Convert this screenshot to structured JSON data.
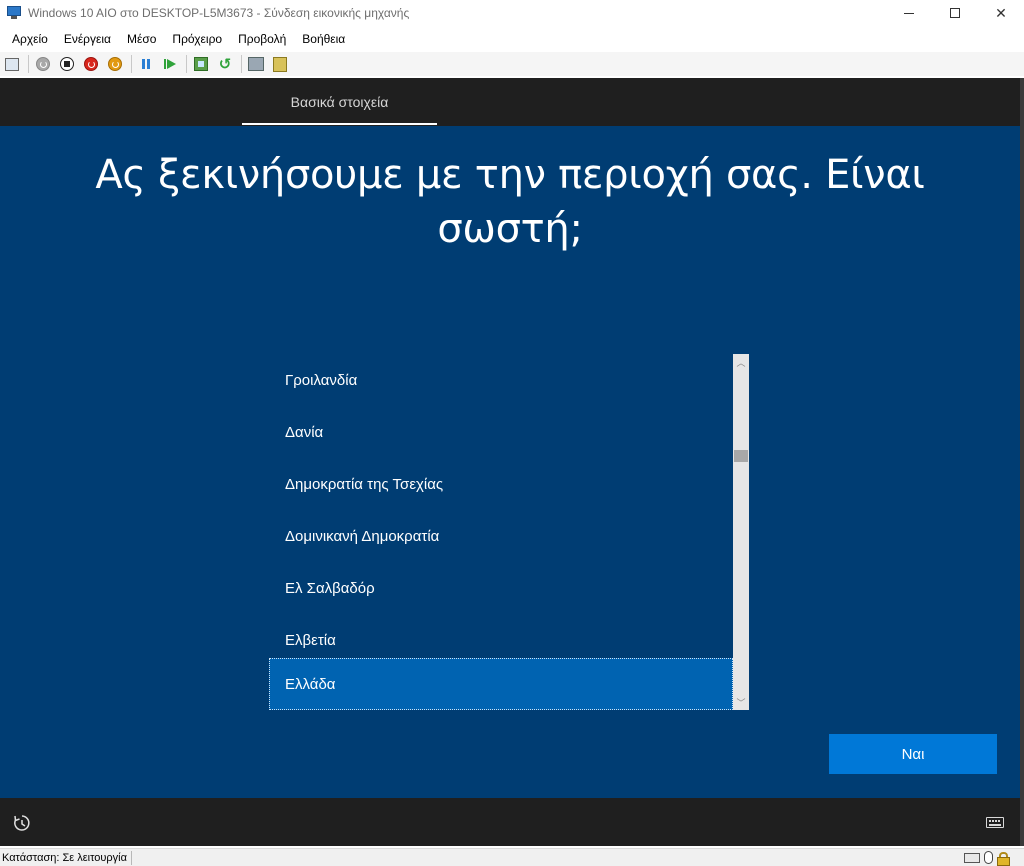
{
  "window": {
    "title": "Windows 10 AIO στο DESKTOP-L5M3673 - Σύνδεση εικονικής μηχανής",
    "close_glyph": "✕"
  },
  "menu": {
    "items": [
      "Αρχείο",
      "Ενέργεια",
      "Μέσο",
      "Πρόχειρο",
      "Προβολή",
      "Βοήθεια"
    ]
  },
  "toolbar": {
    "icons": [
      "ctrl-alt-del-icon",
      "start-icon",
      "turn-off-icon",
      "shut-down-icon",
      "save-icon",
      "pause-icon",
      "resume-icon",
      "checkpoint-icon",
      "revert-icon",
      "enhanced-session-icon",
      "share-icon"
    ],
    "undo_glyph": "↺"
  },
  "oobe": {
    "tab_label": "Βασικά στοιχεία",
    "heading": "Ας ξεκινήσουμε με την περιοχή σας. Είναι σωστή;",
    "regions": [
      "Γροιλανδία",
      "Δανία",
      "Δημοκρατία της Τσεχίας",
      "Δομινικανή Δημοκρατία",
      "Ελ Σαλβαδόρ",
      "Ελβετία",
      "Ελλάδα"
    ],
    "selected_region": "Ελλάδα",
    "yes_button": "Ναι",
    "scroll_up_glyph": "︿",
    "scroll_down_glyph": "﹀",
    "accent_color": "#0078d7",
    "background_color": "#003d73"
  },
  "status": {
    "text": "Κατάσταση: Σε λειτουργία"
  }
}
